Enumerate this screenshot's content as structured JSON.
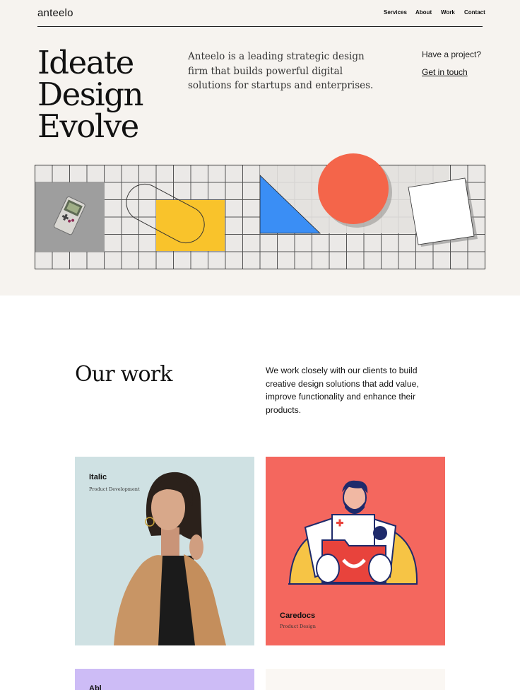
{
  "header": {
    "logo": "anteelo",
    "nav": [
      "Services",
      "About",
      "Work",
      "Contact"
    ]
  },
  "hero": {
    "title_lines": [
      "Ideate",
      "Design",
      "Evolve"
    ],
    "description": "Anteelo is a leading strategic design firm that builds powerful digital solutions for startups and enterprises.",
    "cta_prompt": "Have a project?",
    "cta_link": "Get in touch"
  },
  "work": {
    "title": "Our work",
    "description": "We work closely with our clients to build creative design solutions that add value, improve functionality and enhance their products.",
    "projects": [
      {
        "title": "Italic",
        "subtitle": "Product Development",
        "color": "#cfe1e3"
      },
      {
        "title": "Caredocs",
        "subtitle": "Product Design",
        "color": "#f4675e"
      },
      {
        "title": "Abl",
        "subtitle": "",
        "color": "#cdbcf6"
      },
      {
        "title": "",
        "subtitle": "",
        "color": "#faf7f3"
      }
    ]
  },
  "colors": {
    "hero_background": "#f6f3ef",
    "shape_yellow": "#f9c32b",
    "shape_blue": "#3a8ef5",
    "shape_coral": "#f4654a"
  }
}
